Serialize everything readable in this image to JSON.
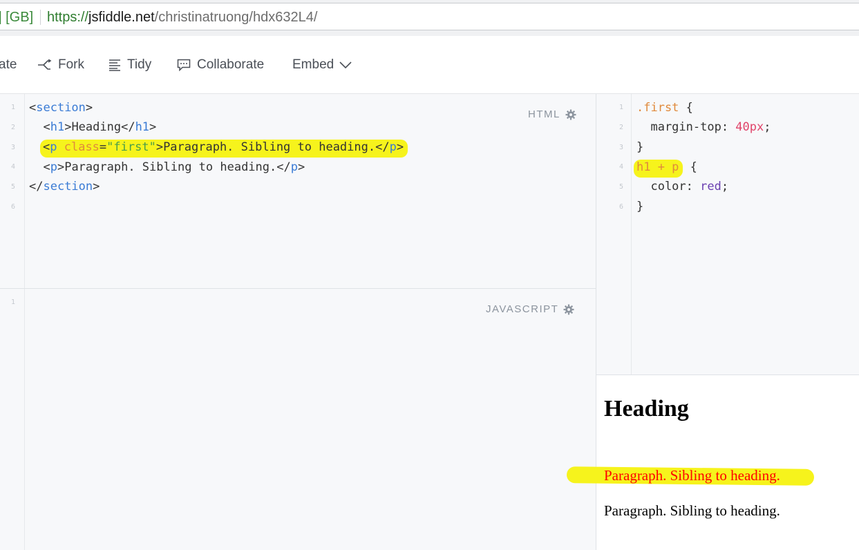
{
  "browser": {
    "ev_badge": "] [GB]",
    "url_scheme": "https://",
    "url_host": "jsfiddle.net",
    "url_path": "/christinatruong/hdx632L4/"
  },
  "toolbar": {
    "update_label": "ate",
    "fork_label": "Fork",
    "tidy_label": "Tidy",
    "collaborate_label": "Collaborate",
    "embed_label": "Embed"
  },
  "html_pane": {
    "label": "HTML",
    "line_numbers": [
      "1",
      "2",
      "3",
      "4",
      "5",
      "6"
    ],
    "lines": [
      {
        "p1": "<",
        "t": "section",
        "p2": ">"
      },
      {
        "p1": "  <",
        "t": "h1",
        "p2": ">Heading</",
        "t2": "h1",
        "p3": ">"
      },
      {
        "p1": "<",
        "t": "p",
        "a": " class",
        "eq": "=",
        "s": "\"first\"",
        "p2": ">Paragraph. Sibling to heading.</",
        "t2": "p",
        "p3": ">"
      },
      {
        "p1": "  <",
        "t": "p",
        "p2": ">Paragraph. Sibling to heading.</",
        "t2": "p",
        "p3": ">"
      },
      {
        "p1": "</",
        "t": "section",
        "p2": ">"
      }
    ]
  },
  "css_pane": {
    "line_numbers": [
      "1",
      "2",
      "3",
      "4",
      "5",
      "6"
    ],
    "lines": [
      {
        "sel": ".first",
        "rest": " {"
      },
      {
        "prop": "  margin-top: ",
        "num": "40px",
        "end": ";"
      },
      {
        "rest": "}"
      },
      {
        "sel": "h1 + p",
        "rest": " {"
      },
      {
        "prop": "  color: ",
        "val": "red",
        "end": ";"
      },
      {
        "rest": "}"
      }
    ]
  },
  "js_pane": {
    "label": "JAVASCRIPT",
    "line_numbers": [
      "1"
    ]
  },
  "result": {
    "heading": "Heading",
    "paragraph_1": "Paragraph. Sibling to heading.",
    "paragraph_2": "Paragraph. Sibling to heading."
  },
  "colors": {
    "highlight": "#f6f31c",
    "url_green": "#2f7d2f",
    "red_text": "#ff0000"
  }
}
